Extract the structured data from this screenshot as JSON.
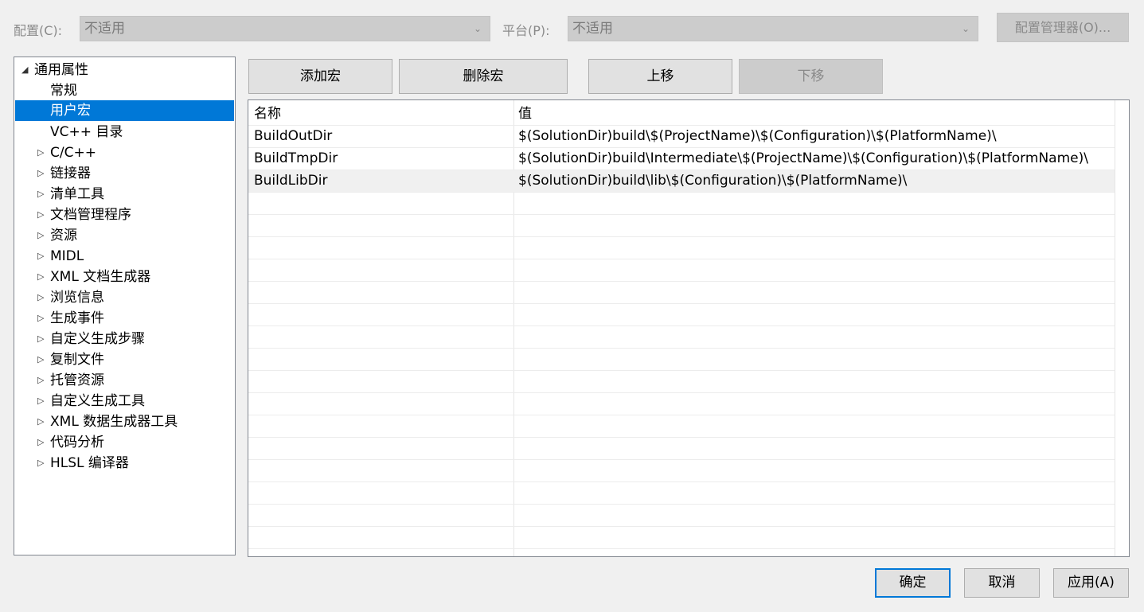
{
  "topbar": {
    "config_label": "配置(C):",
    "config_value": "不适用",
    "platform_label": "平台(P):",
    "platform_value": "不适用",
    "config_manager_label": "配置管理器(O)..."
  },
  "tree": {
    "items": [
      {
        "label": "通用属性",
        "expanded": true
      },
      {
        "label": "常规"
      },
      {
        "label": "用户宏",
        "selected": true
      },
      {
        "label": "VC++ 目录"
      },
      {
        "label": "C/C++"
      },
      {
        "label": "链接器"
      },
      {
        "label": "清单工具"
      },
      {
        "label": "文档管理程序"
      },
      {
        "label": "资源"
      },
      {
        "label": "MIDL"
      },
      {
        "label": "XML 文档生成器"
      },
      {
        "label": "浏览信息"
      },
      {
        "label": "生成事件"
      },
      {
        "label": "自定义生成步骤"
      },
      {
        "label": "复制文件"
      },
      {
        "label": "托管资源"
      },
      {
        "label": "自定义生成工具"
      },
      {
        "label": "XML 数据生成器工具"
      },
      {
        "label": "代码分析"
      },
      {
        "label": "HLSL 编译器"
      }
    ]
  },
  "actions": {
    "add_macro": "添加宏",
    "delete_macro": "删除宏",
    "move_up": "上移",
    "move_down": "下移"
  },
  "grid": {
    "columns": {
      "name": "名称",
      "value": "值"
    },
    "rows": [
      {
        "name": "BuildOutDir",
        "value": "$(SolutionDir)build\\$(ProjectName)\\$(Configuration)\\$(PlatformName)\\"
      },
      {
        "name": "BuildTmpDir",
        "value": "$(SolutionDir)build\\Intermediate\\$(ProjectName)\\$(Configuration)\\$(PlatformName)\\"
      },
      {
        "name": "BuildLibDir",
        "value": "$(SolutionDir)build\\lib\\$(Configuration)\\$(PlatformName)\\"
      }
    ]
  },
  "dialog": {
    "ok": "确定",
    "cancel": "取消",
    "apply": "应用(A)"
  },
  "colors": {
    "selection": "#0078d7",
    "default_button_border": "#0078d7"
  },
  "icons": {
    "expanded": "triangle-down-icon",
    "collapsed": "triangle-right-icon",
    "dropdown": "chevron-down-icon"
  }
}
